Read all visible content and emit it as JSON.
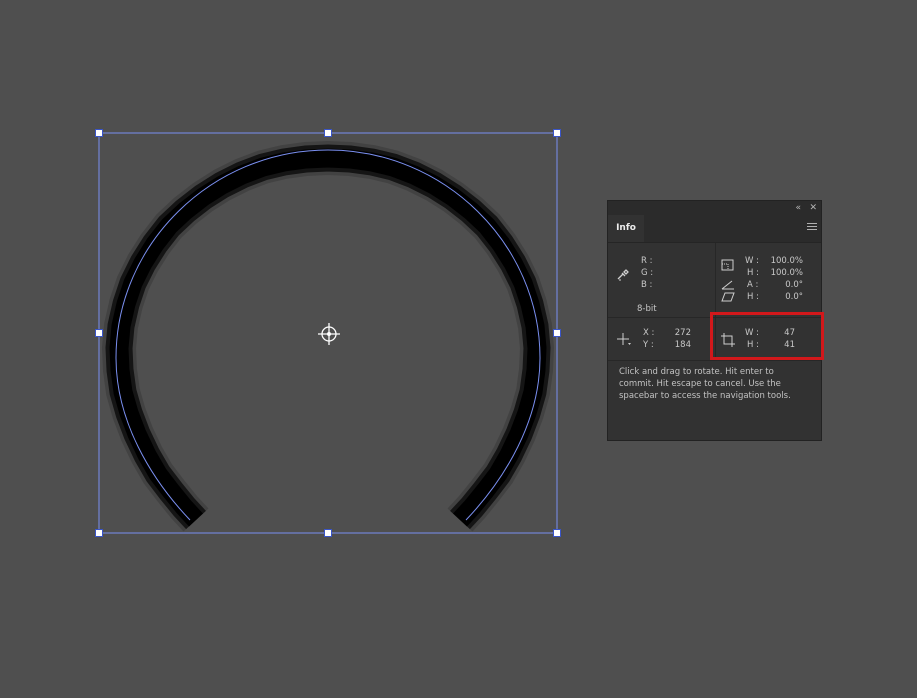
{
  "panel": {
    "collapse_icon": "«",
    "close_icon": "✕",
    "tab_label": "Info",
    "color": {
      "r_label": "R :",
      "g_label": "G :",
      "b_label": "B :",
      "r_value": "",
      "g_value": "",
      "b_value": "",
      "bit_depth": "8-bit"
    },
    "transform": {
      "w_label": "W :",
      "w_value": "100.0%",
      "h_label": "H :",
      "h_value": "100.0%",
      "a_label": "A :",
      "a_value": "0.0°",
      "skew_label": "H :",
      "skew_value": "0.0°"
    },
    "position": {
      "x_label": "X :",
      "x_value": "272",
      "y_label": "Y :",
      "y_value": "184"
    },
    "size": {
      "w_label": "W :",
      "w_value": "47",
      "h_label": "H :",
      "h_value": "41"
    },
    "hint_text": "Click and drag to rotate. Hit enter to commit. Hit escape to cancel. Use the spacebar to access the navigation tools."
  },
  "colors": {
    "canvas_bg": "#4f4f4f",
    "panel_bg": "#323232",
    "selection_line": "#7a8ff0",
    "highlight": "#d2181b",
    "arc": "#000000"
  }
}
